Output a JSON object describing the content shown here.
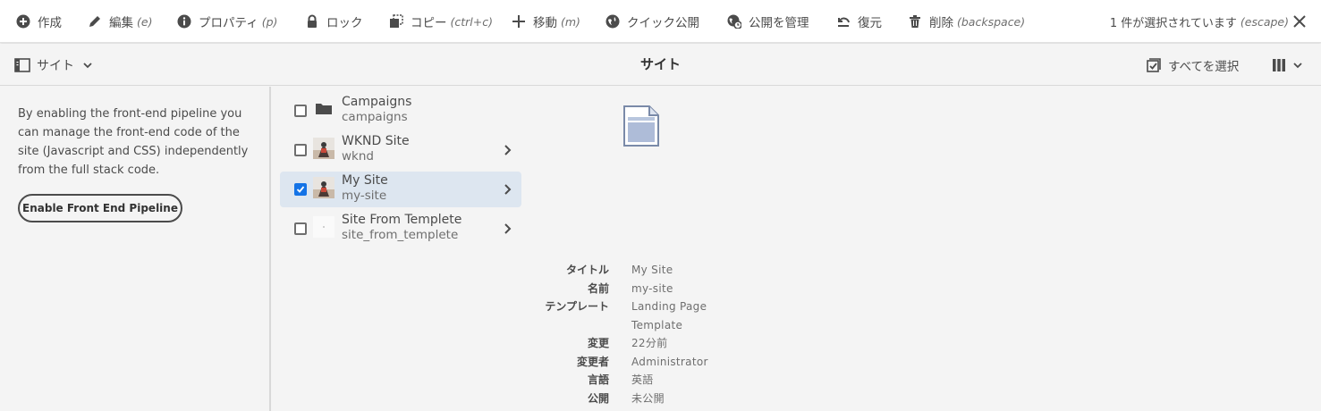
{
  "toolbar": {
    "create": "作成",
    "edit": "編集",
    "edit_shortcut": "(e)",
    "properties": "プロパティ",
    "properties_shortcut": "(p)",
    "lock": "ロック",
    "copy": "コピー",
    "copy_shortcut": "(ctrl+c)",
    "move": "移動",
    "move_shortcut": "(m)",
    "quick_publish": "クイック公開",
    "manage_publication": "公開を管理",
    "restore": "復元",
    "delete": "削除",
    "delete_shortcut": "(backspace)",
    "selection_status": "1 件が選択されています",
    "selection_shortcut": "(escape)"
  },
  "header": {
    "rail_label": "サイト",
    "title": "サイト",
    "select_all": "すべてを選択"
  },
  "rail": {
    "description": "By enabling the front-end pipeline you can manage the front-end code of the site (Javascript and CSS) independently from the full stack code.",
    "button": "Enable Front End Pipeline"
  },
  "items": [
    {
      "title": "Campaigns",
      "name": "campaigns",
      "icon": "folder-icon",
      "selected": false,
      "has_children": false
    },
    {
      "title": "WKND Site",
      "name": "wknd",
      "icon": "site-thumbnail",
      "selected": false,
      "has_children": true
    },
    {
      "title": "My Site",
      "name": "my-site",
      "icon": "site-thumbnail",
      "selected": true,
      "has_children": true
    },
    {
      "title": "Site From Templete",
      "name": "site_from_templete",
      "icon": "blank-thumbnail",
      "selected": false,
      "has_children": true
    }
  ],
  "preview": {
    "icon": "page-icon",
    "meta": [
      {
        "label": "タイトル",
        "value": "My Site"
      },
      {
        "label": "名前",
        "value": "my-site"
      },
      {
        "label": "テンプレート",
        "value": "Landing Page Template"
      },
      {
        "label": "変更",
        "value": "22分前"
      },
      {
        "label": "変更者",
        "value": "Administrator"
      },
      {
        "label": "言語",
        "value": "英語"
      },
      {
        "label": "公開",
        "value": "未公開"
      }
    ]
  },
  "colors": {
    "accent": "#1473e6",
    "selected_row": "#dde6f0",
    "background": "#f4f4f4"
  }
}
